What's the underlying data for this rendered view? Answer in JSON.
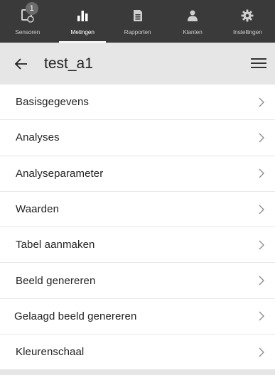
{
  "nav": {
    "items": [
      {
        "label": "Sensoren",
        "icon": "sensor-icon",
        "badge": "1"
      },
      {
        "label": "Metingen",
        "icon": "bar-chart-icon"
      },
      {
        "label": "Rapporten",
        "icon": "report-icon"
      },
      {
        "label": "Klanten",
        "icon": "users-icon"
      },
      {
        "label": "Instellingen",
        "icon": "gear-icon"
      }
    ],
    "active": "Metingen"
  },
  "titlebar": {
    "title": "test_a1",
    "back_icon": "arrow-left-icon",
    "menu_icon": "hamburger-menu-icon"
  },
  "menu": {
    "items": [
      {
        "label": "Basisgegevens"
      },
      {
        "label": "Analyses"
      },
      {
        "label": "Analyseparameter"
      },
      {
        "label": "Waarden"
      },
      {
        "label": "Tabel aanmaken"
      },
      {
        "label": "Beeld genereren"
      },
      {
        "label": "Gelaagd beeld genereren"
      },
      {
        "label": "Kleurenschaal"
      }
    ]
  },
  "colors": {
    "nav_bg": "#3a3a3a",
    "titlebar_bg": "#e6e6e6",
    "row_bg": "#ffffff",
    "divider": "#e7e7e7"
  }
}
